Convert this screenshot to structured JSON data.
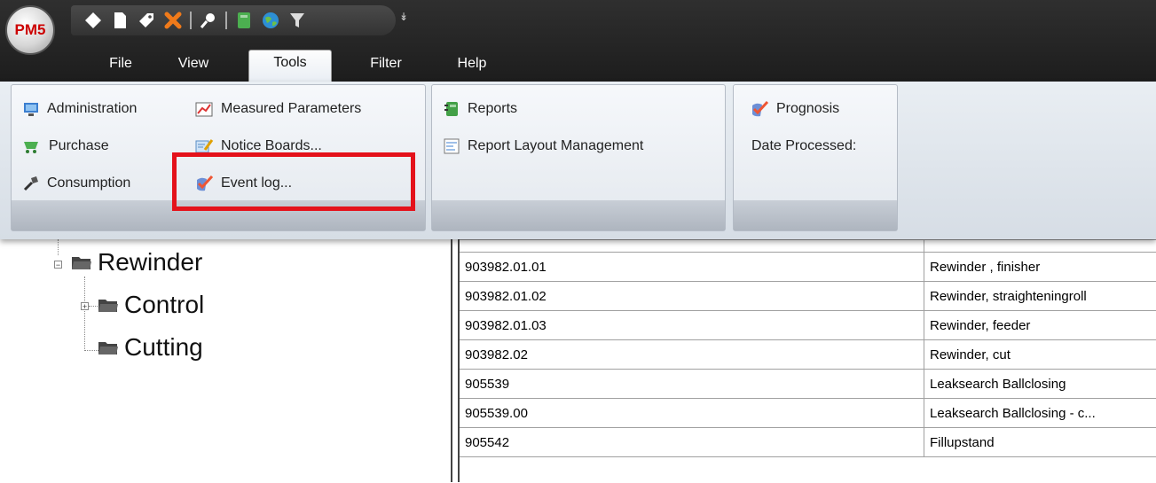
{
  "app": {
    "logo_text": "PM5"
  },
  "quick_access": {
    "icons": [
      "new-icon",
      "document-icon",
      "tag-icon",
      "delete-icon",
      "search-icon",
      "notebook-icon",
      "globe-icon",
      "filter-icon"
    ],
    "more_glyph": "↡"
  },
  "tabs": [
    {
      "label": "File"
    },
    {
      "label": "View"
    },
    {
      "label": "Tools"
    },
    {
      "label": "Filter"
    },
    {
      "label": "Help"
    }
  ],
  "ribbon": {
    "group1": {
      "administration": "Administration",
      "measured_parameters": "Measured Parameters",
      "purchase": "Purchase",
      "notice_boards": "Notice Boards...",
      "consumption": "Consumption",
      "event_log": "Event log..."
    },
    "group2": {
      "reports": "Reports",
      "report_layout": "Report Layout Management"
    },
    "group3": {
      "prognosis": "Prognosis",
      "date_processed": "Date Processed:"
    }
  },
  "tree": {
    "root": "Rewinder",
    "child1": "Control",
    "child2": "Cutting"
  },
  "grid": {
    "rows": [
      {
        "code": "903982.01.01",
        "desc": "Rewinder , finisher"
      },
      {
        "code": "903982.01.02",
        "desc": "Rewinder, straighteningroll"
      },
      {
        "code": "903982.01.03",
        "desc": "Rewinder, feeder"
      },
      {
        "code": "903982.02",
        "desc": "Rewinder, cut"
      },
      {
        "code": "905539",
        "desc": "Leaksearch Ballclosing"
      },
      {
        "code": "905539.00",
        "desc": "Leaksearch Ballclosing - c..."
      },
      {
        "code": "905542",
        "desc": "Fillupstand"
      }
    ]
  },
  "colors": {
    "highlight": "#e4121b",
    "accent_logo": "#cc0000"
  }
}
